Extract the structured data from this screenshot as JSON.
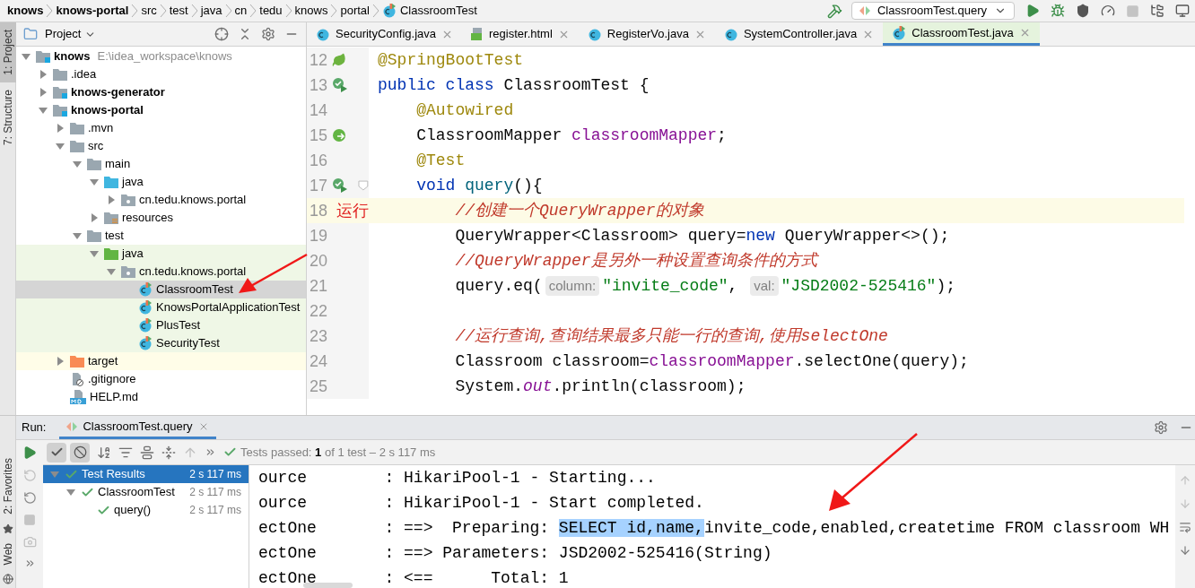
{
  "breadcrumb": [
    {
      "label": "knows",
      "bold": true,
      "kind": "module"
    },
    {
      "label": "knows-portal",
      "bold": true,
      "kind": "module"
    },
    {
      "label": "src",
      "bold": false,
      "kind": "dir"
    },
    {
      "label": "test",
      "bold": false,
      "kind": "dir"
    },
    {
      "label": "java",
      "bold": false,
      "kind": "dir"
    },
    {
      "label": "cn",
      "bold": false,
      "kind": "dir"
    },
    {
      "label": "tedu",
      "bold": false,
      "kind": "dir"
    },
    {
      "label": "knows",
      "bold": false,
      "kind": "dir"
    },
    {
      "label": "portal",
      "bold": false,
      "kind": "dir"
    },
    {
      "label": "ClassroomTest",
      "bold": false,
      "kind": "class"
    }
  ],
  "run_config": "ClassroomTest.query",
  "side_tabs": [
    {
      "label": "1: Project",
      "selected": true
    },
    {
      "label": "7: Structure",
      "selected": false
    }
  ],
  "bottom_side_tabs": [
    {
      "label": "2: Favorites",
      "selected": false
    },
    {
      "label": "Web",
      "selected": false
    }
  ],
  "project_panel": {
    "title": "Project"
  },
  "tree": [
    {
      "label": "knows",
      "path": "E:\\idea_workspace\\knows",
      "kind": "module",
      "bold": true,
      "expanded": true,
      "selected": false,
      "children": [
        {
          "label": ".idea",
          "kind": "folder",
          "bold": false,
          "expanded": false,
          "selected": false
        },
        {
          "label": "knows-generator",
          "kind": "module",
          "bold": true,
          "expanded": false,
          "selected": false
        },
        {
          "label": "knows-portal",
          "kind": "module",
          "bold": true,
          "expanded": true,
          "selected": false,
          "children": [
            {
              "label": ".mvn",
              "kind": "folder",
              "bold": false,
              "expanded": false,
              "selected": false
            },
            {
              "label": "src",
              "kind": "folder",
              "bold": false,
              "expanded": true,
              "selected": false,
              "children": [
                {
                  "label": "main",
                  "kind": "folder",
                  "bold": false,
                  "expanded": true,
                  "selected": false,
                  "children": [
                    {
                      "label": "java",
                      "kind": "source",
                      "bold": false,
                      "expanded": true,
                      "selected": false,
                      "children": [
                        {
                          "label": "cn.tedu.knows.portal",
                          "kind": "package",
                          "bold": false,
                          "expanded": false,
                          "selected": false
                        }
                      ]
                    },
                    {
                      "label": "resources",
                      "kind": "resources",
                      "bold": false,
                      "expanded": false,
                      "selected": false
                    }
                  ]
                },
                {
                  "label": "test",
                  "kind": "folder",
                  "bold": false,
                  "expanded": true,
                  "selected": false,
                  "children": [
                    {
                      "label": "java",
                      "kind": "test-source",
                      "test_scope": true,
                      "bold": false,
                      "expanded": true,
                      "selected": false,
                      "children": [
                        {
                          "label": "cn.tedu.knows.portal",
                          "kind": "package",
                          "test_scope": true,
                          "bold": false,
                          "expanded": true,
                          "selected": false,
                          "children": [
                            {
                              "label": "ClassroomTest",
                              "kind": "class",
                              "test_scope": true,
                              "bold": false,
                              "selected": true
                            },
                            {
                              "label": "KnowsPortalApplicationTest",
                              "kind": "class",
                              "test_scope": true,
                              "bold": false,
                              "selected": false
                            },
                            {
                              "label": "PlusTest",
                              "kind": "class",
                              "test_scope": true,
                              "bold": false,
                              "selected": false
                            },
                            {
                              "label": "SecurityTest",
                              "kind": "class",
                              "test_scope": true,
                              "bold": false,
                              "selected": false
                            }
                          ]
                        }
                      ]
                    }
                  ]
                }
              ]
            },
            {
              "label": "target",
              "kind": "excluded",
              "excluded": true,
              "bold": false,
              "expanded": false,
              "selected": false
            },
            {
              "label": ".gitignore",
              "kind": "gitignore",
              "bold": false,
              "selected": false
            },
            {
              "label": "HELP.md",
              "kind": "md",
              "bold": false,
              "selected": false
            }
          ]
        }
      ]
    }
  ],
  "tabs": [
    {
      "label": "SecurityConfig.java",
      "kind": "class",
      "selected": false
    },
    {
      "label": "register.html",
      "kind": "html",
      "selected": false
    },
    {
      "label": "RegisterVo.java",
      "kind": "class",
      "selected": false
    },
    {
      "label": "SystemController.java",
      "kind": "class",
      "selected": false
    },
    {
      "label": "ClassroomTest.java",
      "kind": "test",
      "selected": true
    }
  ],
  "code": [
    {
      "number": "12",
      "kind": "spring",
      "current": false,
      "tokens": [
        {
          "kind": "annotation",
          "text": "@SpringBootTest"
        }
      ]
    },
    {
      "number": "13",
      "kind": "run",
      "current": false,
      "tokens": [
        {
          "kind": "keyword",
          "text": "public class "
        },
        {
          "kind": "plain",
          "text": "ClassroomTest {"
        }
      ]
    },
    {
      "number": "14",
      "current": false,
      "tokens": [
        {
          "kind": "annotation",
          "text": "    @Autowired"
        }
      ]
    },
    {
      "number": "15",
      "kind": "bean",
      "current": false,
      "tokens": [
        {
          "kind": "plain",
          "text": "    ClassroomMapper "
        },
        {
          "kind": "field",
          "text": "classroomMapper"
        },
        {
          "kind": "plain",
          "text": ";"
        }
      ]
    },
    {
      "number": "16",
      "current": false,
      "tokens": [
        {
          "kind": "annotation",
          "text": "    @Test"
        }
      ]
    },
    {
      "number": "17",
      "kind": "run",
      "fold": true,
      "current": false,
      "tokens": [
        {
          "kind": "keyword",
          "text": "    void "
        },
        {
          "kind": "method",
          "text": "query"
        },
        {
          "kind": "plain",
          "text": "(){"
        }
      ]
    },
    {
      "number": "18",
      "note": "运行",
      "current": true,
      "tokens": [
        {
          "kind": "comment",
          "text": "        //创建一个QueryWrapper的对象"
        }
      ]
    },
    {
      "number": "19",
      "current": false,
      "tokens": [
        {
          "kind": "plain",
          "text": "        QueryWrapper<Classroom> query="
        },
        {
          "kind": "keyword",
          "text": "new"
        },
        {
          "kind": "plain",
          "text": " QueryWrapper<>();"
        }
      ]
    },
    {
      "number": "20",
      "current": false,
      "tokens": [
        {
          "kind": "comment",
          "text": "        //QueryWrapper是另外一种设置查询条件的方式"
        }
      ]
    },
    {
      "number": "21",
      "current": false,
      "tokens": [
        {
          "kind": "plain",
          "text": "        query.eq("
        },
        {
          "kind": "hint",
          "text": "column:"
        },
        {
          "kind": "string",
          "text": "\"invite_code\""
        },
        {
          "kind": "plain",
          "text": ", "
        },
        {
          "kind": "hint",
          "text": "val:"
        },
        {
          "kind": "string",
          "text": "\"JSD2002-525416\""
        },
        {
          "kind": "plain",
          "text": ");"
        }
      ]
    },
    {
      "number": "22",
      "current": false
    },
    {
      "number": "23",
      "current": false,
      "tokens": [
        {
          "kind": "comment",
          "text": "        //运行查询,查询结果最多只能一行的查询,使用selectOne"
        }
      ]
    },
    {
      "number": "24",
      "current": false,
      "tokens": [
        {
          "kind": "plain",
          "text": "        Classroom classroom="
        },
        {
          "kind": "field",
          "text": "classroomMapper"
        },
        {
          "kind": "plain",
          "text": ".selectOne(query);"
        }
      ]
    },
    {
      "number": "25",
      "current": false,
      "tokens": [
        {
          "kind": "plain",
          "text": "        System."
        },
        {
          "kind": "static",
          "text": "out"
        },
        {
          "kind": "plain",
          "text": ".println(classroom);"
        }
      ]
    }
  ],
  "run": {
    "label": "Run:",
    "tabs": [
      {
        "label": "ClassroomTest.query",
        "selected": true
      }
    ],
    "status": "Tests passed: **1** of 1 test – 2 s 117 ms",
    "results": [
      {
        "label": "Test Results",
        "time": "2 s 117 ms",
        "selected": true,
        "expanded": true,
        "children": [
          {
            "label": "ClassroomTest",
            "time": "2 s 117 ms",
            "selected": false,
            "expanded": true,
            "children": [
              {
                "label": "query()",
                "time": "2 s 117 ms",
                "selected": false
              }
            ]
          }
        ]
      }
    ],
    "console": [
      [
        {
          "text": "ource        : HikariPool-1 - Starting...",
          "selected": false
        }
      ],
      [
        {
          "text": "ource        : HikariPool-1 - Start completed.",
          "selected": false
        }
      ],
      [
        {
          "text": "ectOne       : ==>  Preparing: ",
          "selected": false
        },
        {
          "text": "SELECT id,name,",
          "selected": true
        },
        {
          "text": "invite_code,enabled,createtime FROM classroom WH",
          "selected": false
        }
      ],
      [
        {
          "text": "ectOne       : ==> Parameters: JSD2002-525416(String)",
          "selected": false
        }
      ],
      [
        {
          "text": "ectOne       : <==      Total: 1",
          "selected": false
        }
      ]
    ]
  }
}
